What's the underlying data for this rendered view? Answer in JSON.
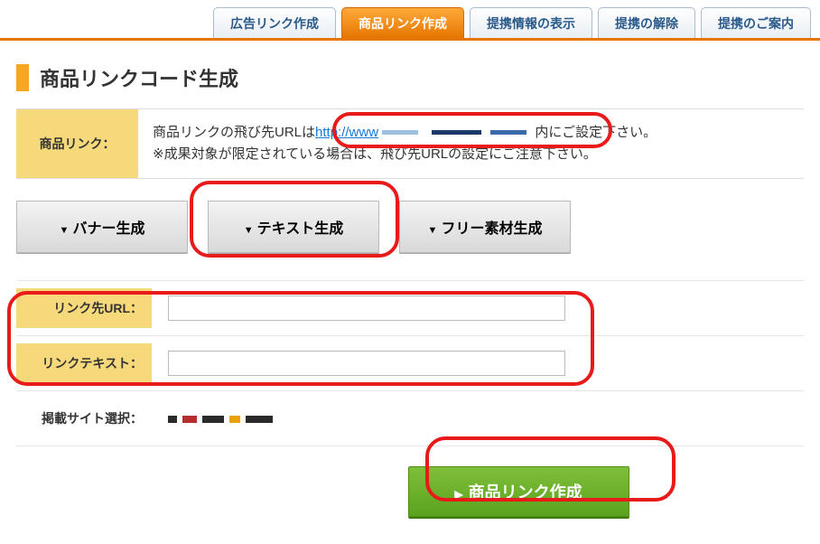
{
  "tabs": {
    "t0": "広告リンク作成",
    "t1": "商品リンク作成",
    "t2": "提携情報の表示",
    "t3": "提携の解除",
    "t4": "提携のご案内"
  },
  "page_title": "商品リンクコード生成",
  "info": {
    "label": "商品リンク：",
    "line1_pre": "商品リンクの飛び先URLは",
    "line1_link": "http://www",
    "line1_post": "内にご設定下さい。",
    "line2": "※成果対象が限定されている場合は、飛び先URLの設定にご注意下さい。"
  },
  "gen": {
    "banner": "バナー生成",
    "text": "テキスト生成",
    "free": "フリー素材生成"
  },
  "form": {
    "url_label": "リンク先URL：",
    "url_value": "",
    "text_label": "リンクテキスト：",
    "text_value": "",
    "site_label": "掲載サイト選択：",
    "site_value": ""
  },
  "submit": "商品リンク作成"
}
